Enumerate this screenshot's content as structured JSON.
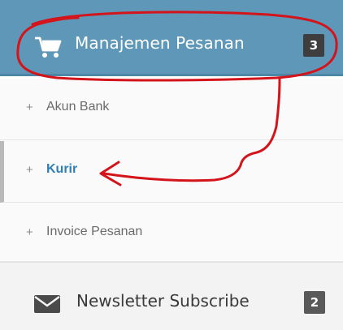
{
  "menu": {
    "header": {
      "label": "Manajemen Pesanan",
      "badge": "3",
      "icon": "shopping-cart-icon"
    },
    "submenu": [
      {
        "prefix": "+",
        "label": "Akun Bank",
        "active": false
      },
      {
        "prefix": "+",
        "label": "Kurir",
        "active": true
      },
      {
        "prefix": "+",
        "label": "Invoice Pesanan",
        "active": false
      }
    ]
  },
  "newsletter": {
    "label": "Newsletter Subscribe",
    "badge": "2",
    "icon": "envelope-icon"
  },
  "colors": {
    "header_bg": "#5e97b7",
    "active_link": "#2f7fb3",
    "badge_bg": "#3e3e3e",
    "annotation": "#d4141b"
  }
}
